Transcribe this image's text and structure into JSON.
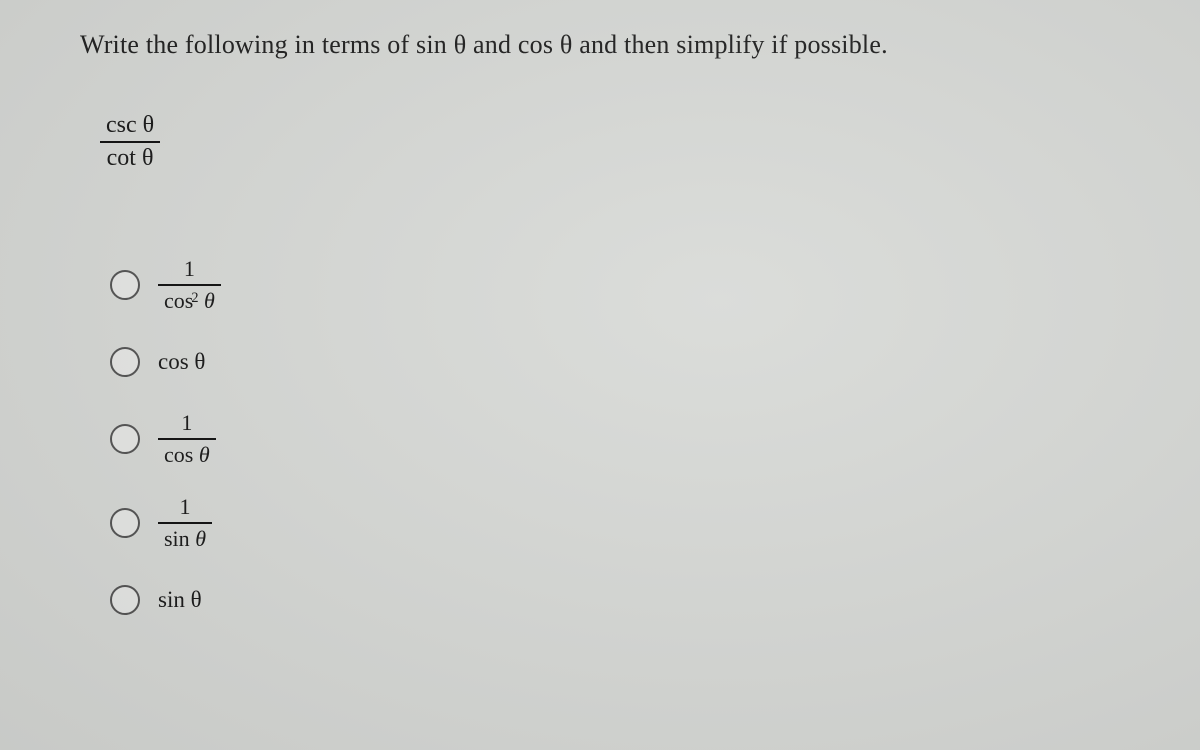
{
  "question": {
    "prompt": "Write the following in terms of sin θ and cos θ and then simplify if possible.",
    "expression": {
      "numerator": "csc θ",
      "denominator": "cot θ"
    }
  },
  "options": [
    {
      "type": "fraction",
      "numerator": "1",
      "denominator_html": "cos<sup>2</sup> <span class='theta'>θ</span>",
      "denominator_plain": "cos² θ"
    },
    {
      "type": "plain",
      "text": "cos θ"
    },
    {
      "type": "fraction",
      "numerator": "1",
      "denominator_html": "cos <span class='theta'>θ</span>",
      "denominator_plain": "cos θ"
    },
    {
      "type": "fraction",
      "numerator": "1",
      "denominator_html": "sin <span class='theta'>θ</span>",
      "denominator_plain": "sin θ"
    },
    {
      "type": "plain",
      "text": "sin θ"
    }
  ]
}
